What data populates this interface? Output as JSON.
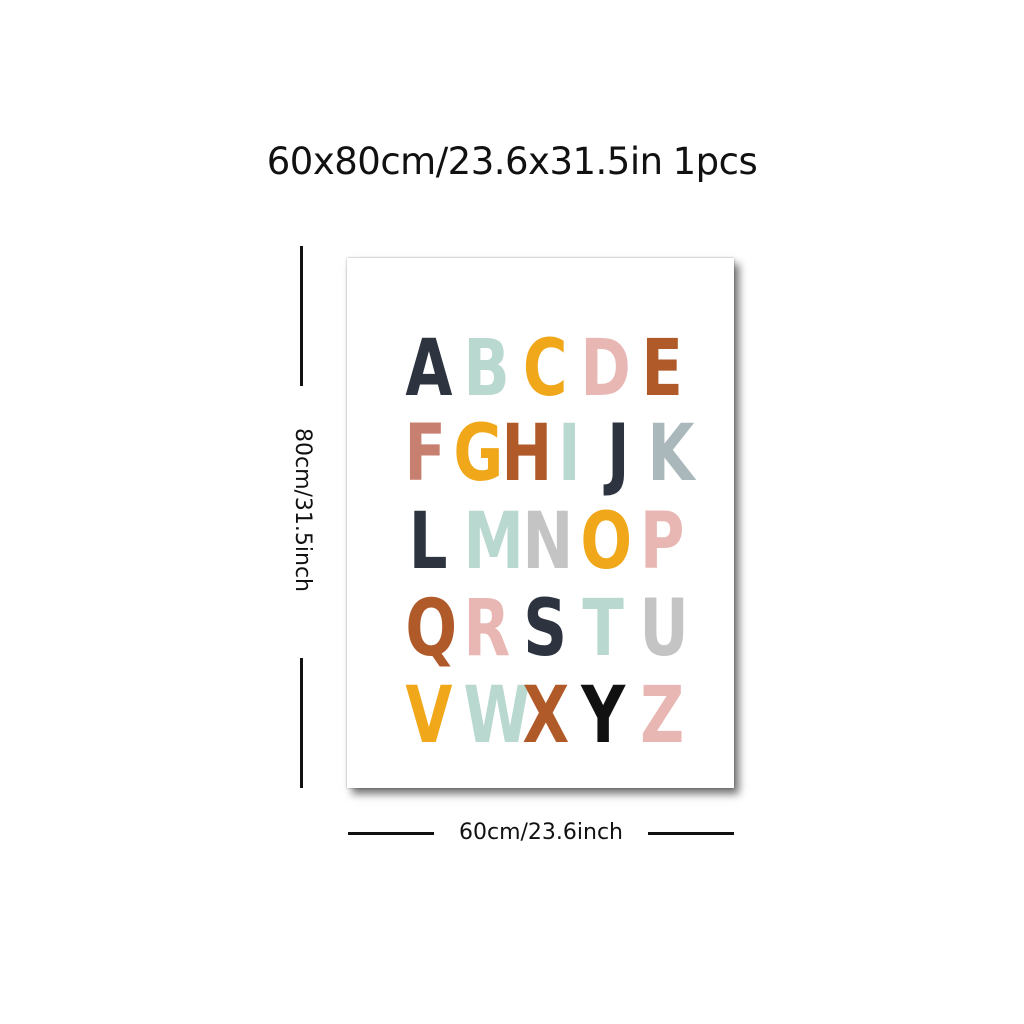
{
  "title": {
    "size_text": "60x80cm/23.6x31.5in",
    "quantity_text": "1pcs"
  },
  "dimensions": {
    "height_label": "80cm/31.5inch",
    "width_label": "60cm/23.6inch"
  },
  "poster": {
    "background": "#ffffff",
    "letters": [
      {
        "char": "A",
        "color": "#2d3440"
      },
      {
        "char": "B",
        "color": "#b8d8d0"
      },
      {
        "char": "C",
        "color": "#f0a81a"
      },
      {
        "char": "D",
        "color": "#e8b7b4"
      },
      {
        "char": "E",
        "color": "#b05a2a"
      },
      {
        "char": "F",
        "color": "#c78070"
      },
      {
        "char": "G",
        "color": "#f0a81a"
      },
      {
        "char": "H",
        "color": "#b05a2a"
      },
      {
        "char": "I",
        "color": "#b8d8d0"
      },
      {
        "char": "J",
        "color": "#2d3440"
      },
      {
        "char": "K",
        "color": "#aab8bc"
      },
      {
        "char": "L",
        "color": "#2d3440"
      },
      {
        "char": "M",
        "color": "#b8d8d0"
      },
      {
        "char": "N",
        "color": "#c4c4c4"
      },
      {
        "char": "O",
        "color": "#f0a81a"
      },
      {
        "char": "P",
        "color": "#e8b7b4"
      },
      {
        "char": "Q",
        "color": "#b05a2a"
      },
      {
        "char": "R",
        "color": "#e8b7b4"
      },
      {
        "char": "S",
        "color": "#2d3440"
      },
      {
        "char": "T",
        "color": "#b8d8d0"
      },
      {
        "char": "U",
        "color": "#c4c4c4"
      },
      {
        "char": "V",
        "color": "#f0a81a"
      },
      {
        "char": "W",
        "color": "#b8d8d0"
      },
      {
        "char": "X",
        "color": "#b05a2a"
      },
      {
        "char": "Y",
        "color": "#111111"
      },
      {
        "char": "Z",
        "color": "#e8b7b4"
      }
    ]
  }
}
